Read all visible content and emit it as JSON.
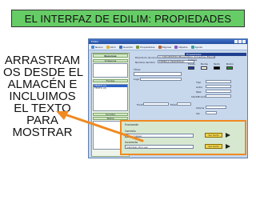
{
  "slide": {
    "title": "EL INTERFAZ DE EDILIM: PROPIEDADES",
    "instruction_lines": [
      "ARRASTRAM",
      "OS DESDE EL",
      "ALMACÉN E",
      "INCLUIMOS",
      "EL TEXTO",
      "PARA",
      "MOSTRAR"
    ]
  },
  "app": {
    "window_title": "Edilim",
    "toolbar": [
      {
        "label": "Nuevo",
        "icon": "new-doc-icon",
        "color": "#4a8ad8"
      },
      {
        "label": "Abrir",
        "icon": "open-folder-icon",
        "color": "#e0b23a"
      },
      {
        "label": "Guardar",
        "icon": "save-icon",
        "color": "#3a6bc0"
      },
      {
        "label": "Propiedades",
        "icon": "properties-icon",
        "color": "#7a9a3a"
      },
      {
        "label": "Páginas",
        "icon": "pages-icon",
        "color": "#c0623a"
      },
      {
        "label": "Objetos",
        "icon": "objects-icon",
        "color": "#8a5ac0"
      },
      {
        "label": "Ayuda",
        "icon": "help-icon",
        "color": "#3aa0a0"
      }
    ],
    "left_panel": {
      "recursos_label": "Recursos",
      "imagenes_label": "Imágenes",
      "fondos_label": "Fondos",
      "list_items": [
        "TEXTO (1)",
        "TEXTO (2)"
      ],
      "sonidos_label": "Sonidos",
      "textos_label": "Textos"
    },
    "main": {
      "directorio_label": "Directorio de recursos",
      "directorio_value": "C:\\ORIGEN\\EDILIM\\ejemplos_proyectos_ESCOLAR PROPIEDAD",
      "nombre_label": "Nombre del libro",
      "nombre_value": "EJEMPLO PROPIEDAD",
      "propiedades_header": "Propiedades",
      "titulo_label": "Título",
      "logo_label": "Logo",
      "fondo_label": "Fondo",
      "musica_label": "Música",
      "colores_label": "Colores",
      "color_cols": [
        "Fondo",
        "Borde",
        "Texto",
        "Botón"
      ],
      "tipo_label": "Tipo",
      "autor_label": "Autor",
      "web_label": "Web",
      "identificacion_label": "Identificación",
      "idioma_label": "Idioma",
      "ver_label": "Ver",
      "swatches": [
        "#1c3aa8",
        "#ffffff",
        "#000000",
        "#1e8f2e"
      ]
    },
    "bottom": {
      "opciones_label": "Opciones",
      "pagina_label": "Página",
      "pagina_value": "1"
    },
    "highlight_box": {
      "heading": "Evaluación",
      "row1_label": "Correcto",
      "row1_value": "Buen trabajo",
      "row1_button": "Ver texto",
      "row2_label": "Incorrecto",
      "row2_value": "Inténtalo otra vez",
      "row2_button": "Ver texto"
    }
  },
  "colors": {
    "title_bg": "#66cc66",
    "arrow": "#f08a22"
  }
}
